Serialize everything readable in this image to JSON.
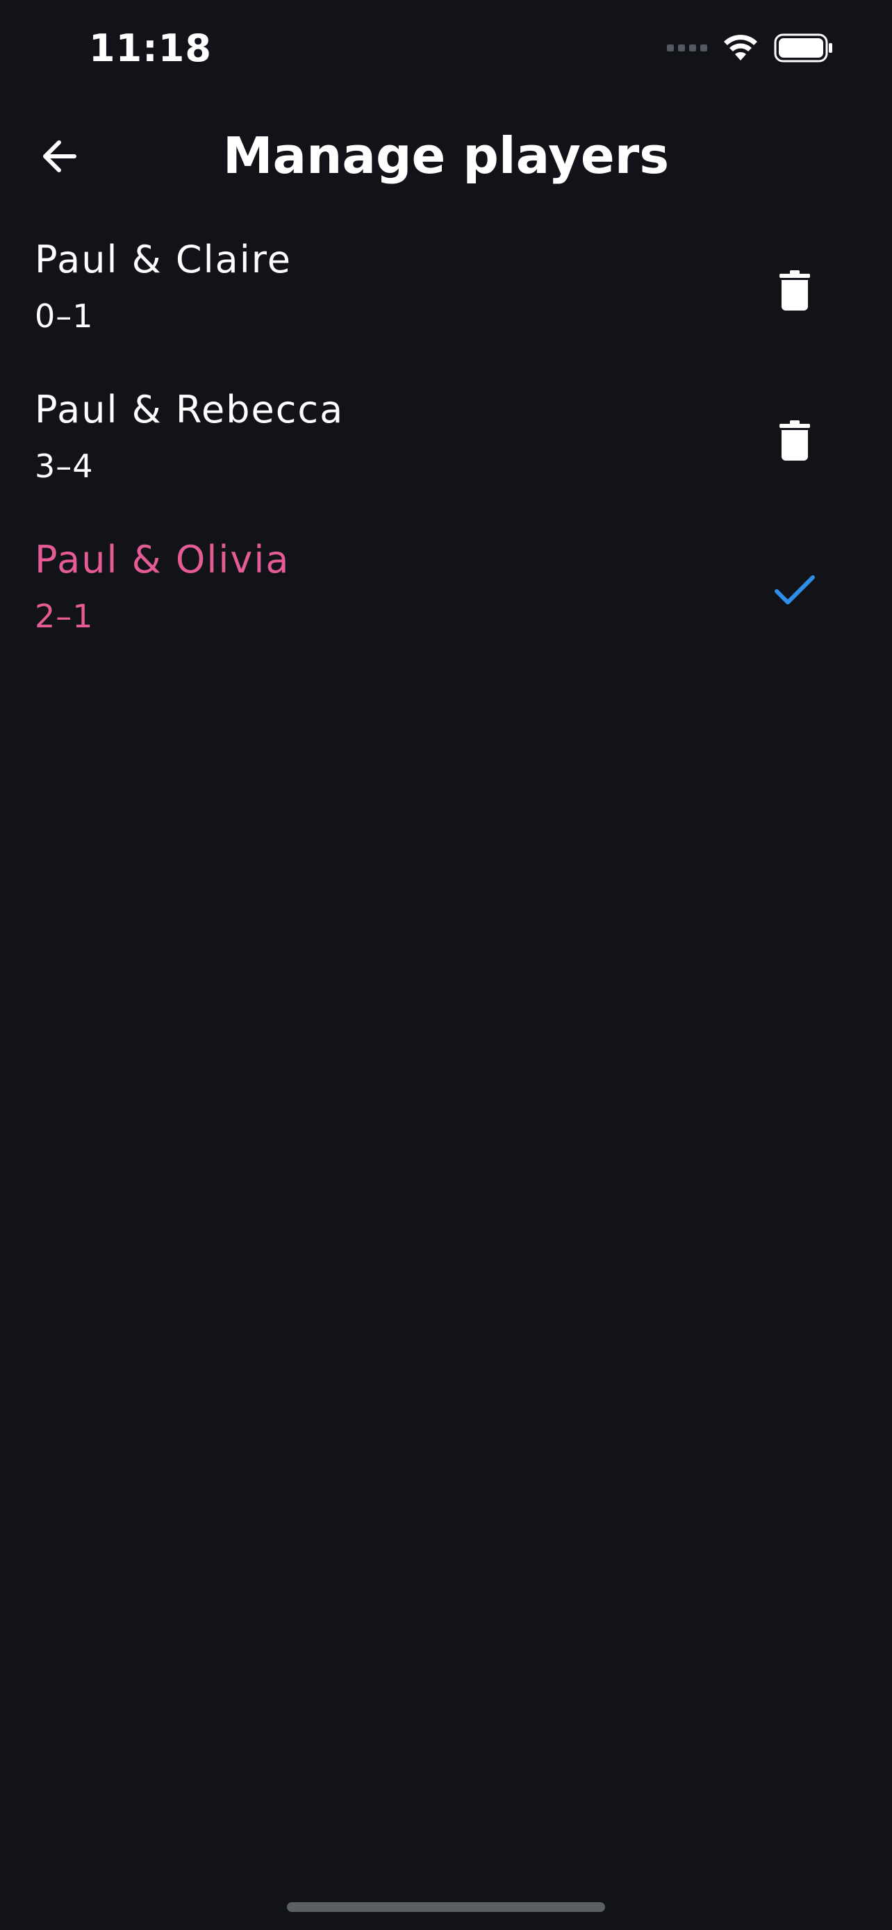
{
  "status_bar": {
    "time": "11:18",
    "icons": [
      "cellular-signal-icon",
      "wifi-icon",
      "battery-icon"
    ]
  },
  "header": {
    "back_icon": "arrow-left-icon",
    "title": "Manage players"
  },
  "players": [
    {
      "name": "Paul & Claire",
      "score": "0–1",
      "action_icon": "trash-icon",
      "selected": false
    },
    {
      "name": "Paul & Rebecca",
      "score": "3–4",
      "action_icon": "trash-icon",
      "selected": false
    },
    {
      "name": "Paul & Olivia",
      "score": "2–1",
      "action_icon": "check-icon",
      "selected": true
    }
  ],
  "colors": {
    "background": "#111318",
    "text": "#ffffff",
    "selected_text": "#e55c93",
    "check": "#2e8ee8",
    "home_indicator": "#5c5f64"
  }
}
